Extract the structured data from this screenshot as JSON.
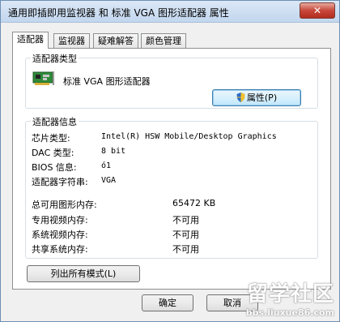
{
  "window": {
    "title": "通用即插即用监视器 和 标准 VGA 图形适配器 属性",
    "close_symbol": "✕"
  },
  "tabs": [
    {
      "label": "适配器",
      "active": true
    },
    {
      "label": "监视器",
      "active": false
    },
    {
      "label": "疑难解答",
      "active": false
    },
    {
      "label": "颜色管理",
      "active": false
    }
  ],
  "adapter_type": {
    "group_label": "适配器类型",
    "name": "标准 VGA 图形适配器",
    "icon": "display-adapter-icon",
    "properties_button": "属性(P)",
    "shield_icon": "uac-shield-icon"
  },
  "adapter_info": {
    "group_label": "适配器信息",
    "rows": [
      {
        "label": "芯片类型:",
        "value": "Intel(R) HSW Mobile/Desktop Graphics"
      },
      {
        "label": "DAC 类型:",
        "value": "8 bit"
      },
      {
        "label": "BIOS 信息:",
        "value": "ó1"
      },
      {
        "label": "适配器字符串:",
        "value": "VGA"
      }
    ],
    "memory_rows": [
      {
        "label": "总可用图形内存:",
        "value": "65472 KB"
      },
      {
        "label": "专用视频内存:",
        "value": "不可用"
      },
      {
        "label": "系统视频内存:",
        "value": "不可用"
      },
      {
        "label": "共享系统内存:",
        "value": "不可用"
      }
    ]
  },
  "list_modes_button": "列出所有模式(L)",
  "footer": {
    "ok_button": "确定",
    "cancel_button": "取消"
  },
  "watermark": {
    "big": "留学社区",
    "small": "bbs.liuxue86.com"
  }
}
